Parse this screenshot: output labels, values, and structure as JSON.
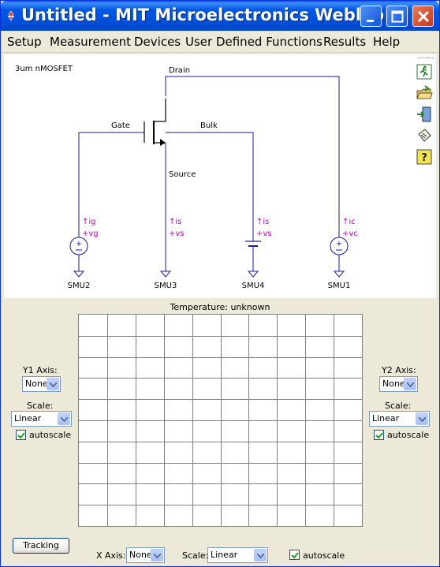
{
  "window": {
    "title": "Untitled - MIT Microelectronics Weblab",
    "controls": [
      "minimize",
      "maximize",
      "close"
    ]
  },
  "menu": [
    "Setup",
    "Measurement",
    "Devices",
    "User Defined Functions",
    "Results",
    "Help"
  ],
  "schematic": {
    "device_label": "3um nMOSFET",
    "terminals": {
      "drain": "Drain",
      "gate": "Gate",
      "bulk": "Bulk",
      "source": "Source"
    },
    "smus": [
      {
        "name": "SMU2",
        "current": "ig",
        "voltage": "vg",
        "source_type": "circle"
      },
      {
        "name": "SMU3",
        "current": "is",
        "voltage": "vs",
        "source_type": "none"
      },
      {
        "name": "SMU4",
        "current": "is",
        "voltage": "vs",
        "source_type": "battery"
      },
      {
        "name": "SMU1",
        "current": "ic",
        "voltage": "vc",
        "source_type": "circle"
      }
    ],
    "colors": {
      "wire": "#1a1aa8",
      "label": "#c000c0"
    }
  },
  "toolbar": {
    "icons": [
      "run-icon",
      "open-folder-icon",
      "exit-door-icon",
      "clipboard-icon",
      "help-icon"
    ]
  },
  "plot": {
    "temperature_label": "Temperature: unknown",
    "grid_cols": 10,
    "grid_rows": 10,
    "y1": {
      "axis_label": "Y1 Axis:",
      "axis_value": "None",
      "scale_label": "Scale:",
      "scale_value": "Linear",
      "autoscale_label": "autoscale",
      "autoscale": true
    },
    "y2": {
      "axis_label": "Y2 Axis:",
      "axis_value": "None",
      "scale_label": "Scale:",
      "scale_value": "Linear",
      "autoscale_label": "autoscale",
      "autoscale": true
    },
    "x": {
      "axis_label": "X Axis:",
      "axis_value": "None",
      "scale_label": "Scale:",
      "scale_value": "Linear",
      "autoscale_label": "autoscale",
      "autoscale": true
    },
    "tracking_button": "Tracking"
  }
}
